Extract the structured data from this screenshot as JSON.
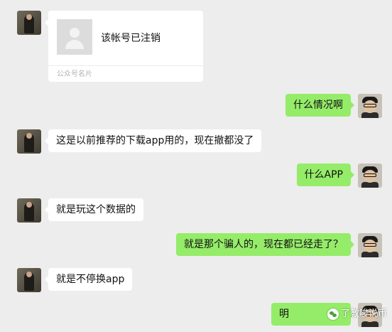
{
  "card": {
    "title": "该帐号已注销",
    "footer": "公众号名片"
  },
  "messages": [
    {
      "side": "right",
      "text": "什么情况啊"
    },
    {
      "side": "left",
      "text": "这是以前推荐的下载app用的，现在撤都没了"
    },
    {
      "side": "right",
      "text": "什么APP"
    },
    {
      "side": "left",
      "text": "就是玩这个数据的"
    },
    {
      "side": "right",
      "text": "就是那个骗人的，现在都已经走了？"
    },
    {
      "side": "left",
      "text": "就是不停换app"
    },
    {
      "side": "right",
      "text": "明"
    }
  ],
  "watermark": "了教唆说币",
  "colors": {
    "background": "#ededed",
    "own_bubble": "#95ec69",
    "other_bubble": "#ffffff"
  }
}
